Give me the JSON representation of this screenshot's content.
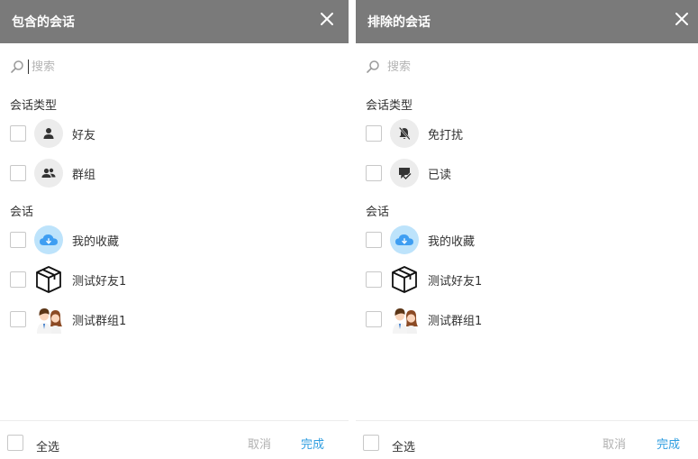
{
  "left": {
    "title": "包含的会话",
    "search_placeholder": "搜索",
    "section_types": "会话类型",
    "types": [
      {
        "label": "好友",
        "icon": "person-icon"
      },
      {
        "label": "群组",
        "icon": "group-icon"
      }
    ],
    "section_sessions": "会话",
    "sessions": [
      {
        "label": "我的收藏",
        "icon": "cloud-icon"
      },
      {
        "label": "测试好友1",
        "icon": "package-box-icon"
      },
      {
        "label": "测试群组1",
        "icon": "couple-avatar-icon"
      }
    ],
    "select_all": "全选",
    "cancel": "取消",
    "done": "完成"
  },
  "right": {
    "title": "排除的会话",
    "search_placeholder": "搜索",
    "section_types": "会话类型",
    "types": [
      {
        "label": "免打扰",
        "icon": "bell-off-icon"
      },
      {
        "label": "已读",
        "icon": "read-message-icon"
      }
    ],
    "section_sessions": "会话",
    "sessions": [
      {
        "label": "我的收藏",
        "icon": "cloud-icon"
      },
      {
        "label": "测试好友1",
        "icon": "package-box-icon"
      },
      {
        "label": "测试群组1",
        "icon": "couple-avatar-icon"
      }
    ],
    "select_all": "全选",
    "cancel": "取消",
    "done": "完成"
  },
  "colors": {
    "header_bg": "#7a7a7a",
    "accent": "#2f9ee0",
    "muted": "#b0b0b0"
  }
}
